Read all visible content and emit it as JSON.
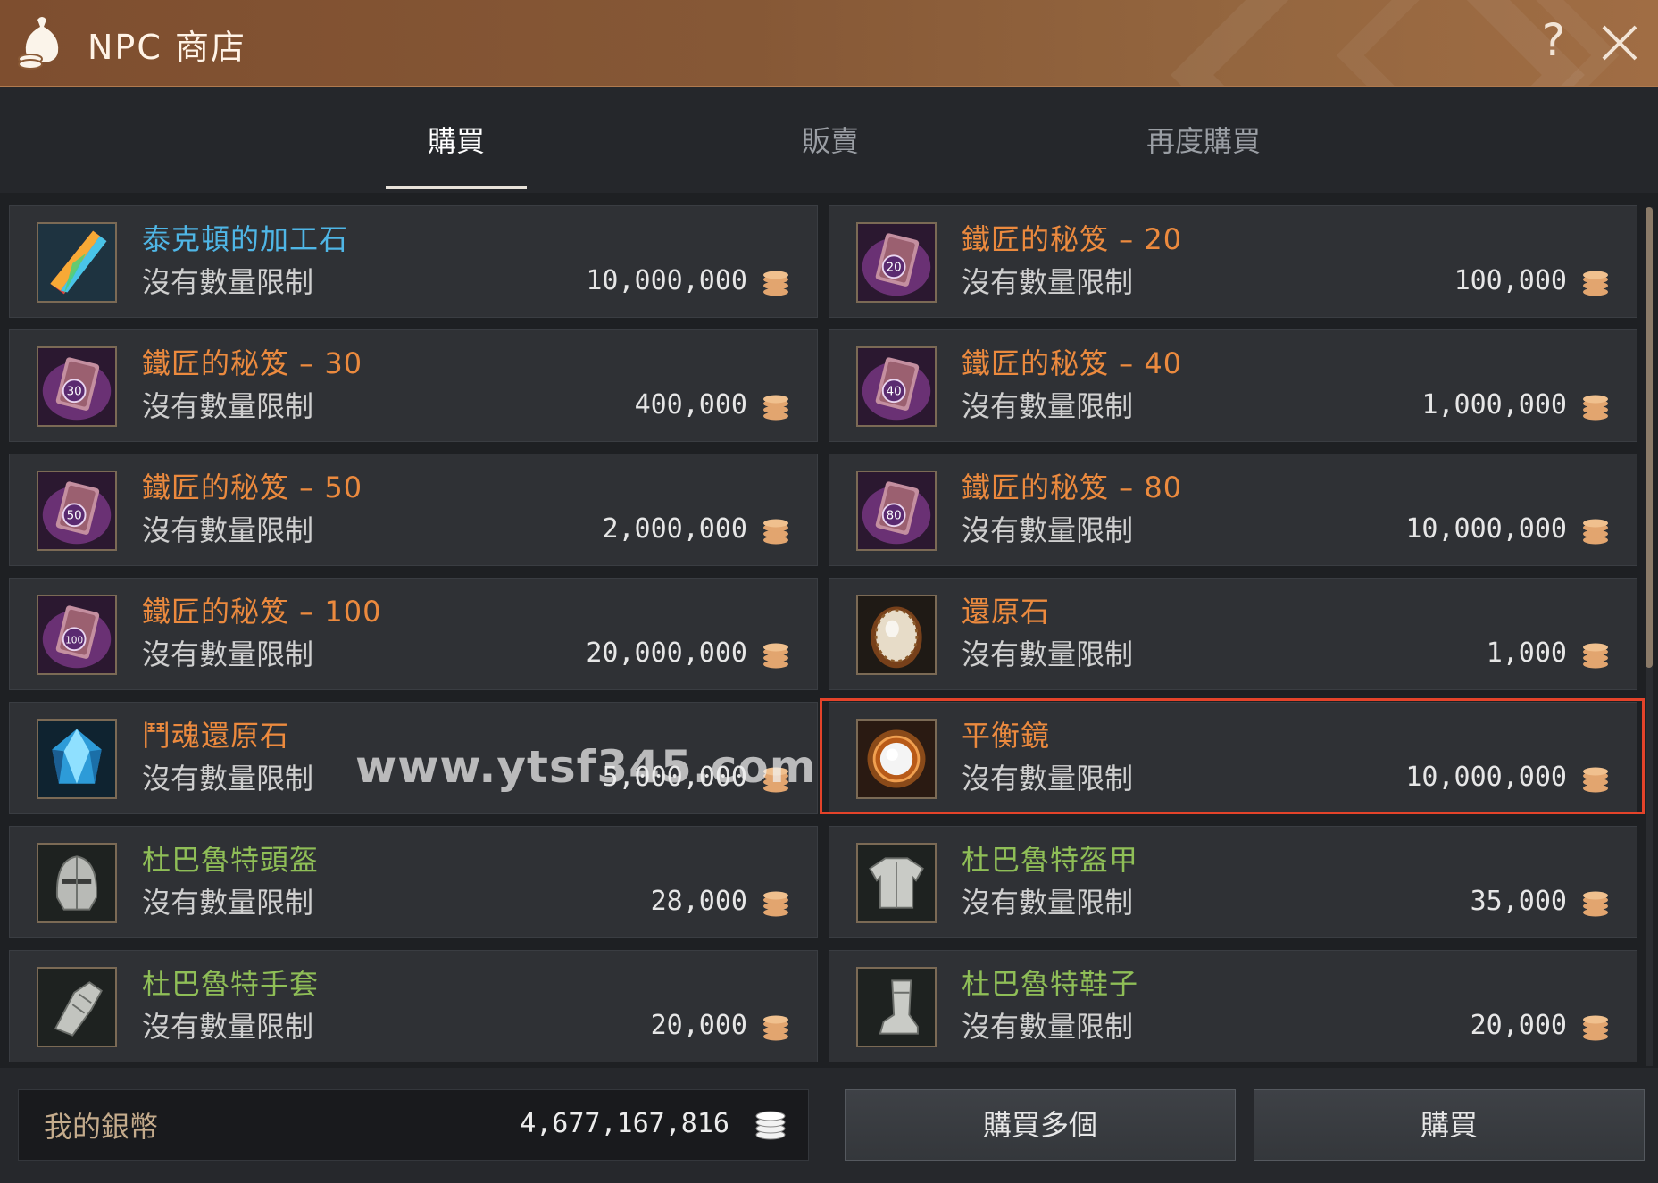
{
  "window": {
    "title": "NPC 商店",
    "help_glyph": "?",
    "accent_color": "#8a5a36",
    "highlight_color": "#e4432a"
  },
  "tabs": [
    {
      "label": "購買",
      "active": true
    },
    {
      "label": "販賣",
      "active": false
    },
    {
      "label": "再度購買",
      "active": false
    }
  ],
  "items": [
    {
      "name": "泰克頓的加工石",
      "limit": "沒有數量限制",
      "price": "10,000,000",
      "name_color": "blue",
      "icon": "rainbow-crystal-icon"
    },
    {
      "name": "鐵匠的秘笈 – 20",
      "limit": "沒有數量限制",
      "price": "100,000",
      "name_color": "orange",
      "icon": "blacksmith-book-icon",
      "badge": "20"
    },
    {
      "name": "鐵匠的秘笈 – 30",
      "limit": "沒有數量限制",
      "price": "400,000",
      "name_color": "orange",
      "icon": "blacksmith-book-icon",
      "badge": "30"
    },
    {
      "name": "鐵匠的秘笈 – 40",
      "limit": "沒有數量限制",
      "price": "1,000,000",
      "name_color": "orange",
      "icon": "blacksmith-book-icon",
      "badge": "40"
    },
    {
      "name": "鐵匠的秘笈 – 50",
      "limit": "沒有數量限制",
      "price": "2,000,000",
      "name_color": "orange",
      "icon": "blacksmith-book-icon",
      "badge": "50"
    },
    {
      "name": "鐵匠的秘笈 – 80",
      "limit": "沒有數量限制",
      "price": "10,000,000",
      "name_color": "orange",
      "icon": "blacksmith-book-icon",
      "badge": "80"
    },
    {
      "name": "鐵匠的秘笈 – 100",
      "limit": "沒有數量限制",
      "price": "20,000,000",
      "name_color": "orange",
      "icon": "blacksmith-book-icon",
      "badge": "100"
    },
    {
      "name": "還原石",
      "limit": "沒有數量限制",
      "price": "1,000",
      "name_color": "orange",
      "icon": "restore-stone-icon"
    },
    {
      "name": "鬥魂還原石",
      "limit": "沒有數量限制",
      "price": "5,000,000",
      "name_color": "orange",
      "icon": "fighting-spirit-stone-icon"
    },
    {
      "name": "平衡鏡",
      "limit": "沒有數量限制",
      "price": "10,000,000",
      "name_color": "orange",
      "icon": "balance-mirror-icon",
      "highlighted": true
    },
    {
      "name": "杜巴魯特頭盔",
      "limit": "沒有數量限制",
      "price": "28,000",
      "name_color": "green",
      "icon": "helmet-icon"
    },
    {
      "name": "杜巴魯特盔甲",
      "limit": "沒有數量限制",
      "price": "35,000",
      "name_color": "green",
      "icon": "armor-icon"
    },
    {
      "name": "杜巴魯特手套",
      "limit": "沒有數量限制",
      "price": "20,000",
      "name_color": "green",
      "icon": "gauntlet-icon"
    },
    {
      "name": "杜巴魯特鞋子",
      "limit": "沒有數量限制",
      "price": "20,000",
      "name_color": "green",
      "icon": "boots-icon"
    }
  ],
  "watermark": "www.ytsf345.com",
  "wallet": {
    "label": "我的銀幣",
    "value": "4,677,167,816",
    "icon": "silver-coin-stack-icon"
  },
  "buttons": {
    "buy_multiple": "購買多個",
    "buy": "購買"
  }
}
